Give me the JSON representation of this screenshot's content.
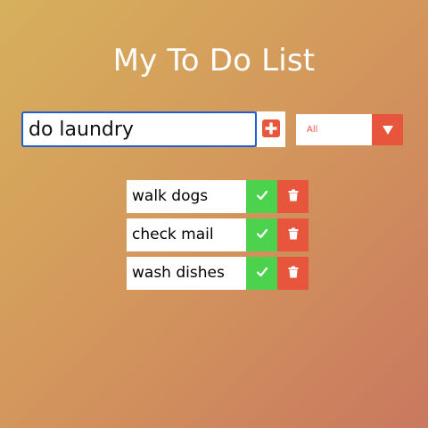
{
  "header": {
    "title": "My To Do List"
  },
  "form": {
    "input_value": "do laundry",
    "add_icon": "plus-square-icon",
    "filter_selected": "All",
    "filter_icon": "caret-down-icon"
  },
  "todos": [
    {
      "text": "walk dogs"
    },
    {
      "text": "check mail"
    },
    {
      "text": "wash dishes"
    }
  ],
  "colors": {
    "complete": "#4cd24c",
    "trash": "#e8553d",
    "input_border": "#1e5fd6"
  }
}
